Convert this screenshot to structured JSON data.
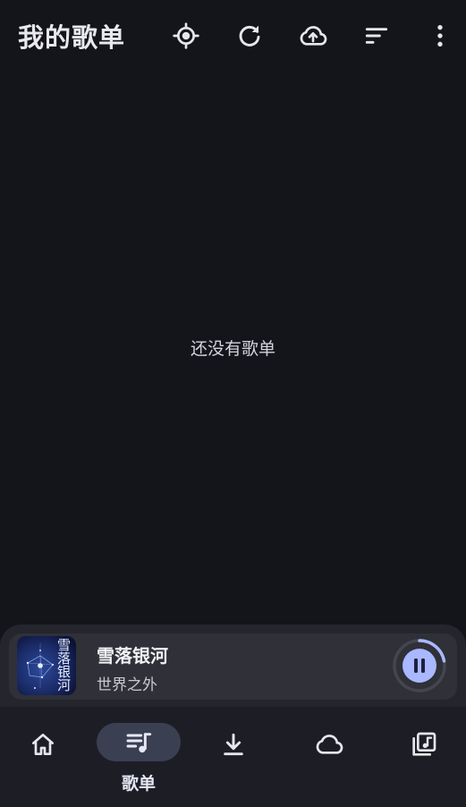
{
  "header": {
    "title": "我的歌单",
    "actions": [
      {
        "icon": "locate-icon"
      },
      {
        "icon": "refresh-icon"
      },
      {
        "icon": "cloud-upload-icon"
      },
      {
        "icon": "sort-icon"
      },
      {
        "icon": "more-vert-icon"
      }
    ]
  },
  "main": {
    "empty_text": "还没有歌单"
  },
  "player": {
    "title": "雪落银河",
    "artist": "世界之外",
    "cover_text": "雪落银河",
    "state": "playing",
    "progress": 0.22,
    "accent": "#a9b8ff"
  },
  "bottom_nav": {
    "items": [
      {
        "icon": "home-icon",
        "label": ""
      },
      {
        "icon": "playlist-icon",
        "label": "歌单",
        "active": true
      },
      {
        "icon": "download-icon",
        "label": ""
      },
      {
        "icon": "cloud-icon",
        "label": ""
      },
      {
        "icon": "music-library-icon",
        "label": ""
      }
    ],
    "active_color": "#3a3f52"
  }
}
